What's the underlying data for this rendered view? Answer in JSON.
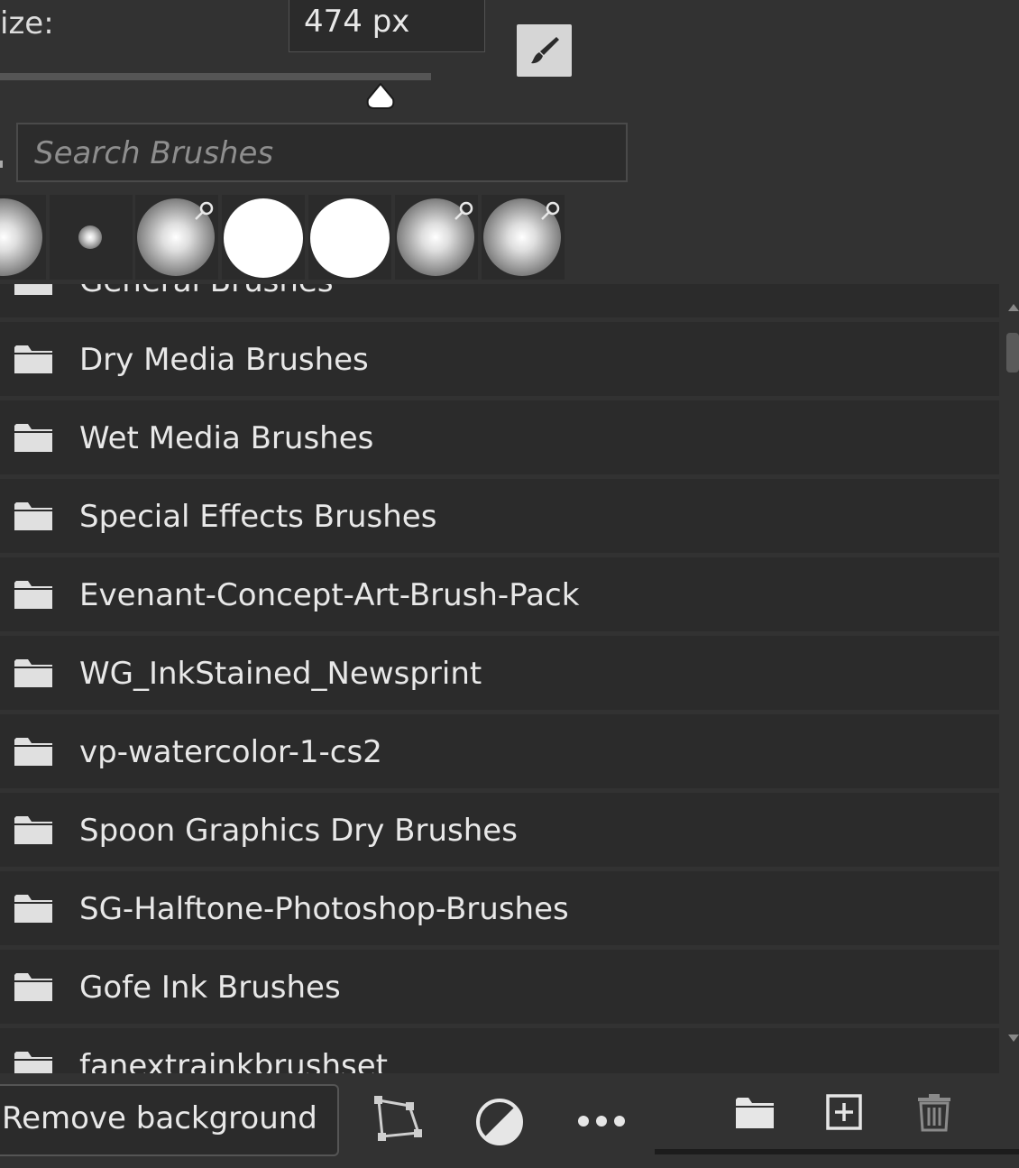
{
  "size": {
    "label": "ize:",
    "value": "474 px"
  },
  "search": {
    "placeholder": "Search Brushes"
  },
  "brush_presets": [
    {
      "type": "soft-round",
      "pressure_pin": false
    },
    {
      "type": "soft-round-small",
      "pressure_pin": false
    },
    {
      "type": "soft-round",
      "pressure_pin": true
    },
    {
      "type": "hard-round",
      "pressure_pin": false
    },
    {
      "type": "hard-round",
      "pressure_pin": false
    },
    {
      "type": "soft-round",
      "pressure_pin": true
    },
    {
      "type": "soft-round",
      "pressure_pin": true
    }
  ],
  "folders": [
    "General Brushes",
    "Dry Media Brushes",
    "Wet Media Brushes",
    "Special Effects Brushes",
    "Evenant-Concept-Art-Brush-Pack",
    "WG_InkStained_Newsprint",
    "vp-watercolor-1-cs2",
    "Spoon Graphics Dry Brushes",
    "SG-Halftone-Photoshop-Brushes",
    "Gofe Ink Brushes",
    "fanextrainkbrushset"
  ],
  "bottom": {
    "remove_background": "Remove background"
  },
  "icons": {
    "brush_tool": "brush-icon",
    "pin": "pin-icon",
    "folder": "folder-icon",
    "path": "path-icon",
    "mask": "half-circle-icon",
    "more": "ellipsis-icon",
    "new_group": "new-folder-icon",
    "new_preset": "add-square-icon",
    "delete": "trash-icon"
  },
  "colors": {
    "panel": "#323232",
    "row": "#2b2b2b",
    "text": "#e8e8e8",
    "placeholder": "#8e8e8e"
  }
}
